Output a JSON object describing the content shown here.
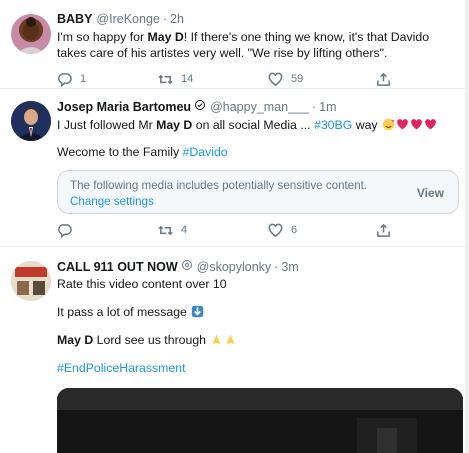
{
  "tweets": [
    {
      "name": "BABY",
      "handle": "@IreKonge",
      "time": "2h",
      "text_1": "I'm so happy for ",
      "text_bold": "May D",
      "text_2": "! If there's one thing we know, it's that Davido takes care of his artistes very well. \"We rise by lifting others\".",
      "replies": "1",
      "retweets": "14",
      "likes": "59"
    },
    {
      "name": "Josep Maria Bartomeu",
      "handle": "@happy_man___",
      "time": "1m",
      "line1_a": "I Just followed Mr ",
      "line1_bold": "May D",
      "line1_b": " on all social Media ... ",
      "line1_tag": "#30BG",
      "line1_c": " way",
      "line2_a": "Wecome to the Family ",
      "line2_tag": "#Davido",
      "sensitive_text": "The following media includes potentially sensitive content.",
      "sensitive_link": "Change settings",
      "sensitive_view": "View",
      "replies": "",
      "retweets": "4",
      "likes": "6"
    },
    {
      "name": "CALL 911 OUT NOW",
      "handle": "@skopylonky",
      "time": "3m",
      "line1": "Rate this video content over 10",
      "line2": "It pass a lot of message",
      "line3_bold": "May D",
      "line3_rest": " Lord see us through",
      "line4_tag": "#EndPoliceHarassment"
    }
  ],
  "colors": {
    "accent": "#1b95e0",
    "muted": "#657786",
    "text": "#14171a",
    "heart_red": "#e0245e"
  },
  "icons": [
    "reply-icon",
    "retweet-icon",
    "like-icon",
    "share-icon",
    "verified-badge-icon",
    "down-arrow-emoji",
    "folded-hands-emoji",
    "heart-emoji",
    "smiling-hearts-emoji"
  ]
}
